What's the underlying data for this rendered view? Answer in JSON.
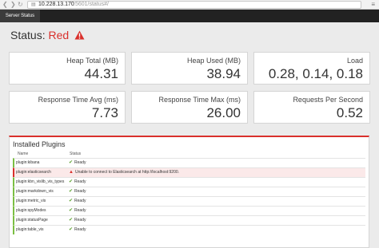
{
  "browser": {
    "url_host": "10.228.13.170",
    "url_rest": ":5601/status#/"
  },
  "nav": {
    "tab_label": "Server Status"
  },
  "status": {
    "label": "Status:",
    "value": "Red"
  },
  "metrics": [
    {
      "label": "Heap Total (MB)",
      "value": "44.31"
    },
    {
      "label": "Heap Used (MB)",
      "value": "38.94"
    },
    {
      "label": "Load",
      "value": "0.28, 0.14, 0.18"
    },
    {
      "label": "Response Time Avg (ms)",
      "value": "7.73"
    },
    {
      "label": "Response Time Max (ms)",
      "value": "26.00"
    },
    {
      "label": "Requests Per Second",
      "value": "0.52"
    }
  ],
  "plugins": {
    "title": "Installed Plugins",
    "col_name": "Name",
    "col_status": "Status",
    "rows": [
      {
        "name": "plugin:kibana",
        "status": "Ready"
      },
      {
        "name": "plugin:elasticsearch",
        "status": "Unable to connect to Elasticsearch at http://localhost:9200."
      },
      {
        "name": "plugin:kbn_vislib_vis_types",
        "status": "Ready"
      },
      {
        "name": "plugin:markdown_vis",
        "status": "Ready"
      },
      {
        "name": "plugin:metric_vis",
        "status": "Ready"
      },
      {
        "name": "plugin:spyModes",
        "status": "Ready"
      },
      {
        "name": "plugin:statusPage",
        "status": "Ready"
      },
      {
        "name": "plugin:table_vis",
        "status": "Ready"
      }
    ]
  },
  "colors": {
    "red": "#d9302c",
    "green": "#5aa02c",
    "nav_bg": "#222222"
  }
}
